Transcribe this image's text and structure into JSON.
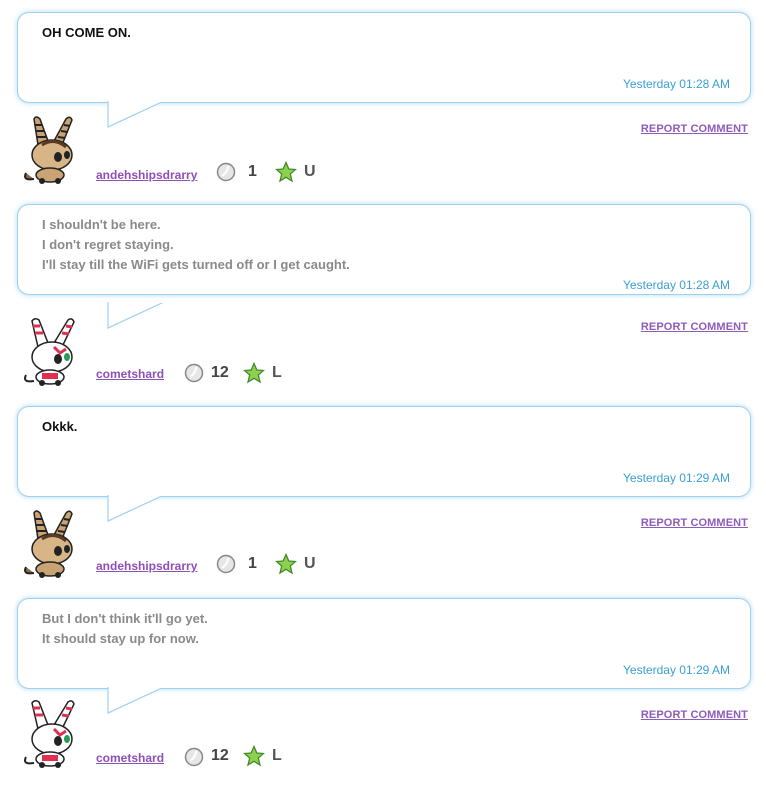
{
  "comments": [
    {
      "lines": [
        "OH COME ON."
      ],
      "timestamp": "Yesterday 01:28 AM",
      "report_label": "REPORT COMMENT",
      "username": "andehshipsdrarry",
      "coins": "1",
      "level": "U",
      "avatar": "tan-bunny-avatar",
      "text_style": "dark"
    },
    {
      "lines": [
        "I shouldn't be here.",
        "I don't regret staying.",
        "I'll stay till the WiFi gets turned off or I get caught."
      ],
      "timestamp": "Yesterday 01:28 AM",
      "report_label": "REPORT COMMENT",
      "username": "cometshard",
      "coins": "12",
      "level": "L",
      "avatar": "white-red-bunny-avatar",
      "text_style": "gray"
    },
    {
      "lines": [
        "Okkk."
      ],
      "timestamp": "Yesterday 01:29 AM",
      "report_label": "REPORT COMMENT",
      "username": "andehshipsdrarry",
      "coins": "1",
      "level": "U",
      "avatar": "tan-bunny-avatar",
      "text_style": "dark"
    },
    {
      "lines": [
        "But I don't think it'll go yet.",
        "It should stay up for now."
      ],
      "timestamp": "Yesterday 01:29 AM",
      "report_label": "REPORT COMMENT",
      "username": "cometshard",
      "coins": "12",
      "level": "L",
      "avatar": "white-red-bunny-avatar",
      "text_style": "gray"
    }
  ],
  "colors": {
    "bubble_border": "#9fd1ef",
    "timestamp": "#3b9fd6",
    "link_purple": "#8e4fb8",
    "star_green": "#8fd14f"
  }
}
